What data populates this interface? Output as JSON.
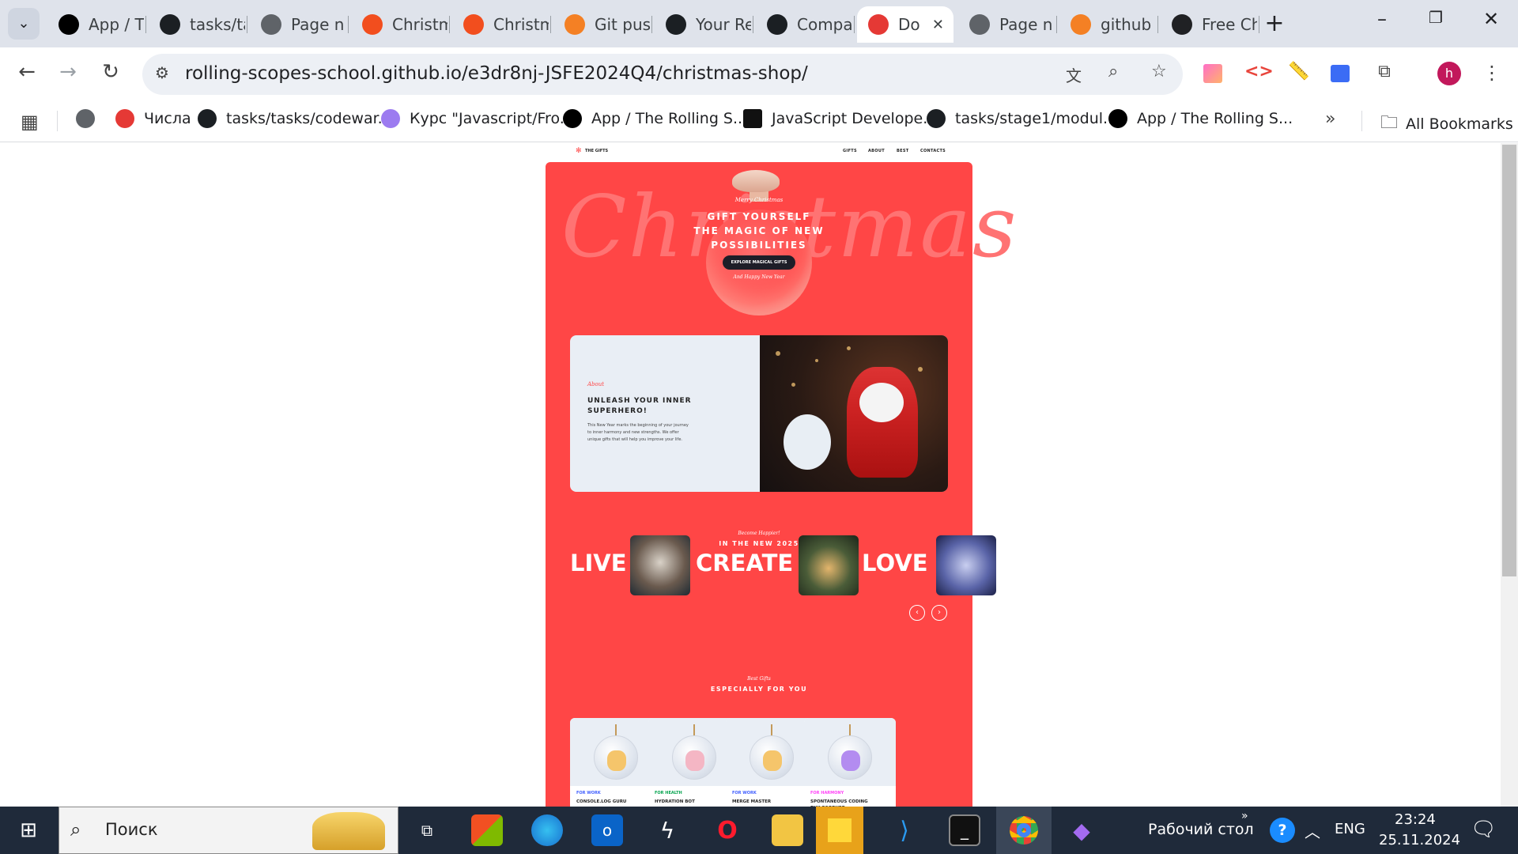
{
  "browser": {
    "tabs": [
      {
        "label": "App / T",
        "icon": "rs-icon",
        "color": "#000000"
      },
      {
        "label": "tasks/ta",
        "icon": "github-icon",
        "color": "#1b1f23"
      },
      {
        "label": "Page n",
        "icon": "globe-icon",
        "color": "#5f6368"
      },
      {
        "label": "Christm",
        "icon": "figma-icon",
        "color": "#f24e1e"
      },
      {
        "label": "Christm",
        "icon": "figma-icon",
        "color": "#f24e1e"
      },
      {
        "label": "Git pus",
        "icon": "stackoverflow-icon",
        "color": "#f48024"
      },
      {
        "label": "Your Re",
        "icon": "github-icon",
        "color": "#1b1f23"
      },
      {
        "label": "Compa",
        "icon": "github-icon",
        "color": "#1b1f23"
      },
      {
        "label": "Do",
        "icon": "santa-icon",
        "color": "#e53935",
        "active": true
      },
      {
        "label": "Page n",
        "icon": "globe-icon",
        "color": "#5f6368"
      },
      {
        "label": "github",
        "icon": "stackoverflow-icon",
        "color": "#f48024"
      },
      {
        "label": "Free Ch",
        "icon": "openai-icon",
        "color": "#202124"
      }
    ],
    "url": "rolling-scopes-school.github.io/e3dr8nj-JSFE2024Q4/christmas-shop/",
    "bookmarks": [
      {
        "label": "",
        "icon": "globe-icon"
      },
      {
        "label": "Числа",
        "icon": "tower-icon"
      },
      {
        "label": "tasks/tasks/codewar...",
        "icon": "github-icon"
      },
      {
        "label": "Курс \"Javascript/Fro...",
        "icon": "course-icon"
      },
      {
        "label": "App / The Rolling S...",
        "icon": "rs-icon"
      },
      {
        "label": "JavaScript Develope...",
        "icon": "notion-icon"
      },
      {
        "label": "tasks/stage1/modul...",
        "icon": "github-icon"
      },
      {
        "label": "App / The Rolling S...",
        "icon": "rs-icon"
      }
    ],
    "all_bookmarks": "All Bookmarks",
    "profile_letter": "h"
  },
  "site": {
    "logo": "THE GIFTS",
    "nav": [
      "GIFTS",
      "ABOUT",
      "BEST",
      "CONTACTS"
    ],
    "hero": {
      "bg_word": "Christmas",
      "script_top": "Merry Christmas",
      "headline": [
        "GIFT YOURSELF",
        "THE MAGIC OF NEW",
        "POSSIBILITIES"
      ],
      "cta": "EXPLORE MAGICAL GIFTS",
      "script_bottom": "And Happy New Year"
    },
    "about": {
      "script": "About",
      "title": [
        "UNLEASH YOUR INNER",
        "SUPERHERO!"
      ],
      "text": [
        "This New Year marks the beginning of your journey",
        "to inner harmony and new strengths. We offer",
        "unique gifts that will help you improve your life."
      ]
    },
    "slider": {
      "script": "Become Happier!",
      "title": "IN THE NEW 2025",
      "words": [
        "LIVE",
        "CREATE",
        "LOVE"
      ],
      "prev": "‹",
      "next": "›"
    },
    "best": {
      "script": "Best Gifts",
      "title": "ESPECIALLY FOR YOU",
      "cards": [
        {
          "category": "FOR WORK",
          "name": "CONSOLE.LOG GURU",
          "cat_color": "#4361ff",
          "ball_tint": "#f5c56b"
        },
        {
          "category": "FOR HEALTH",
          "name": "HYDRATION BOT",
          "cat_color": "#06a44f",
          "ball_tint": "#f4b6c4"
        },
        {
          "category": "FOR WORK",
          "name": "MERGE MASTER",
          "cat_color": "#4361ff",
          "ball_tint": "#f5c56b"
        },
        {
          "category": "FOR HARMONY",
          "name": "SPONTANEOUS CODING PHILOSOPHER",
          "cat_color": "#ff43f7",
          "ball_tint": "#b38cf0"
        }
      ]
    }
  },
  "taskbar": {
    "search_placeholder": "Поиск",
    "desktop_label": "Рабочий стол",
    "lang": "ENG",
    "time": "23:24",
    "date": "25.11.2024"
  }
}
